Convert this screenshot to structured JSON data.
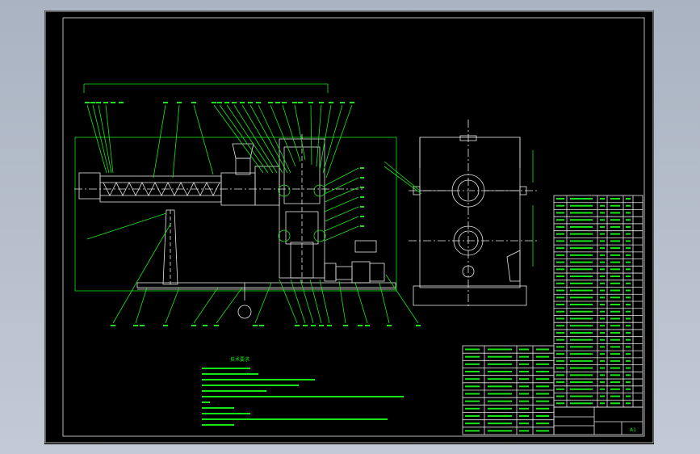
{
  "colors": {
    "background": "#000000",
    "line_green": "#19e619",
    "line_white": "#e8e8e8",
    "viewport": "#b7bfcc"
  },
  "drawing": {
    "tech_heading": "技术要求",
    "parts_table_rows": 30,
    "title_block_rows": 12,
    "corner_mark": "A1"
  }
}
